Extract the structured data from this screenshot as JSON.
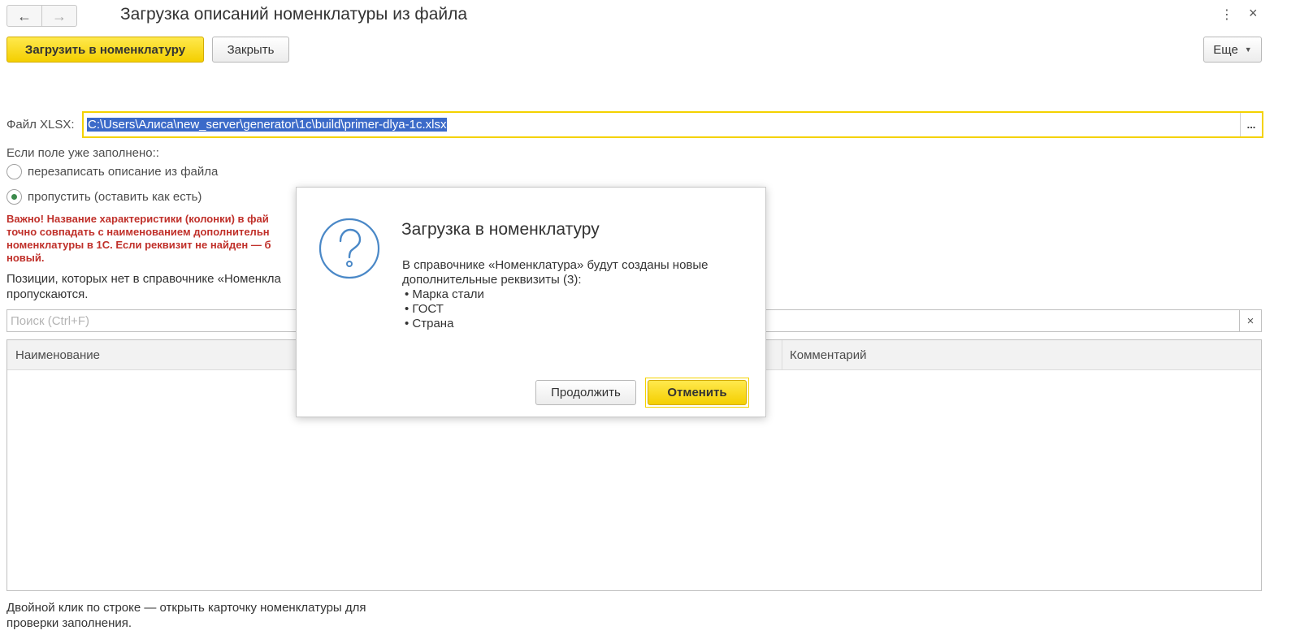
{
  "window": {
    "title": "Загрузка описаний номенклатуры из файла",
    "back_icon": "←",
    "forward_icon": "→",
    "menu_icon": "⋮",
    "close_icon": "×"
  },
  "toolbar": {
    "load_label": "Загрузить в номенклатуру",
    "close_label": "Закрыть",
    "more_label": "Еще",
    "more_caret": "▼"
  },
  "file": {
    "label": "Файл XLSX:",
    "value": "C:\\Users\\Алиса\\new_server\\generator\\1c\\build\\primer-dlya-1c.xlsx",
    "choose_label": "..."
  },
  "mode": {
    "label": "Если поле уже заполнено::",
    "options": [
      {
        "label": "перезаписать описание из файла",
        "selected": false
      },
      {
        "label": "пропустить (оставить как есть)",
        "selected": true
      }
    ]
  },
  "warning": {
    "lines": [
      "Важно! Название характеристики (колонки) в фай",
      "точно совпадать с наименованием дополнительн",
      "номенклатуры в 1С. Если реквизит не найден — б",
      "новый."
    ]
  },
  "note": {
    "lines": [
      "Позиции, которых нет в справочнике «Номенкла",
      "пропускаются."
    ]
  },
  "search": {
    "placeholder": "Поиск (Ctrl+F)",
    "clear_icon": "×"
  },
  "table": {
    "columns": [
      "Наименование",
      "Комментарий"
    ],
    "rows": []
  },
  "hint": {
    "lines": [
      "Двойной клик по строке — открыть карточку номенклатуры для",
      "проверки заполнения."
    ]
  },
  "dialog": {
    "title": "Загрузка в номенклатуру",
    "message_lines": [
      "В справочнике «Номенклатура» будут созданы новые",
      "дополнительные реквизиты (3):",
      "• Марка стали",
      "• ГОСТ",
      "• Страна"
    ],
    "continue_label": "Продолжить",
    "cancel_label": "Отменить",
    "icon": "question-icon"
  },
  "colors": {
    "accent_yellow": "#f4d200",
    "warning_red": "#c0302a",
    "selection_blue": "#3b6ac9",
    "icon_blue": "#4a88c7"
  }
}
